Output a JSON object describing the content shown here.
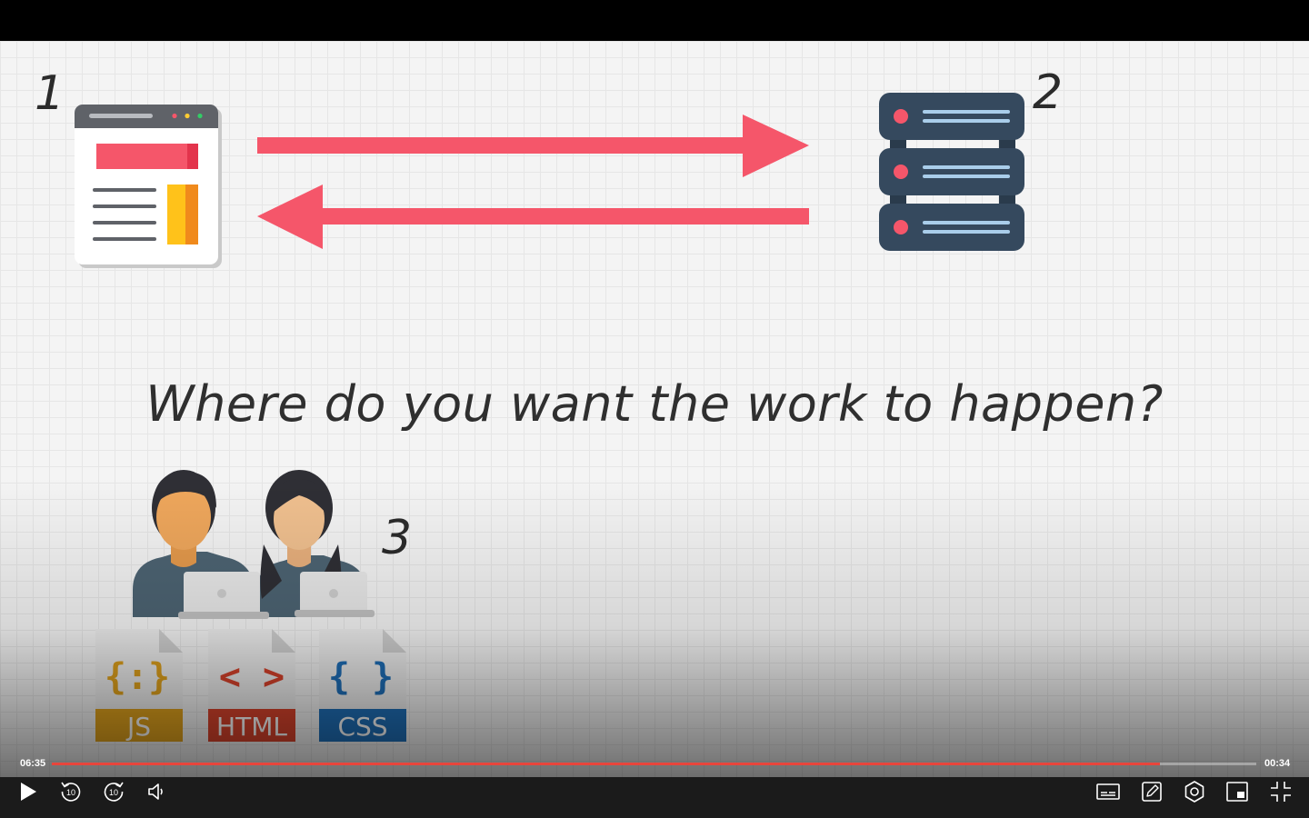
{
  "slide": {
    "label_1": "1",
    "label_2": "2",
    "label_3": "3",
    "question": "Where do you want the work to happen?",
    "files": {
      "js": "JS",
      "html": "HTML",
      "css": "CSS"
    },
    "colors": {
      "arrow": "#f5566a",
      "server": "#35495e",
      "js": "#e0a21d",
      "html": "#d9432c",
      "css": "#1f6fb8"
    }
  },
  "player": {
    "elapsed": "06:35",
    "remaining": "00:34",
    "progress": 0.92,
    "skip_back_label": "10",
    "skip_forward_label": "10",
    "icons": [
      "play-icon",
      "rewind-10-icon",
      "forward-10-icon",
      "volume-icon",
      "captions-icon",
      "notes-icon",
      "settings-icon",
      "picture-in-picture-icon",
      "exit-fullscreen-icon"
    ]
  }
}
